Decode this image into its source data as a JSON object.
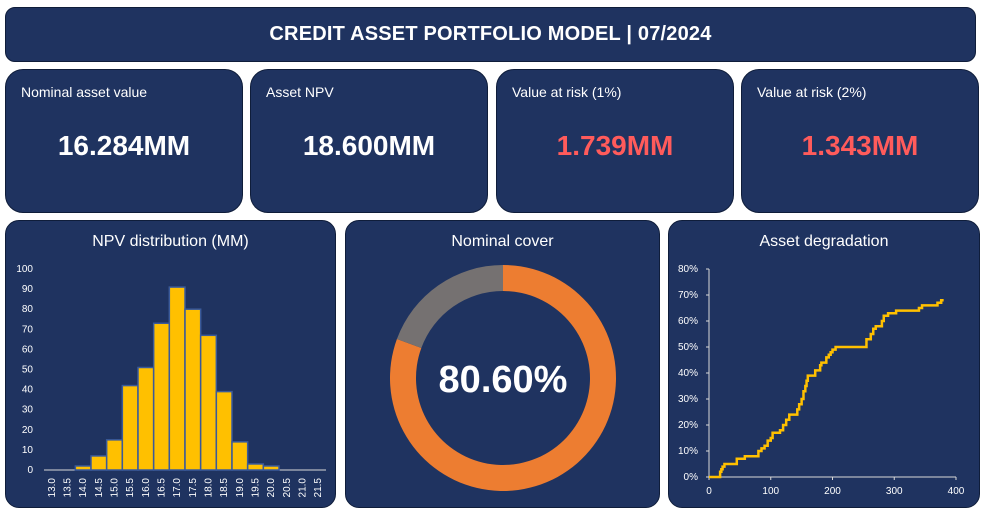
{
  "header": {
    "title": "CREDIT ASSET PORTFOLIO MODEL | 07/2024"
  },
  "kpis": [
    {
      "label": "Nominal asset value",
      "value": "16.284MM",
      "color": "#ffffff"
    },
    {
      "label": "Asset NPV",
      "value": "18.600MM",
      "color": "#ffffff"
    },
    {
      "label": "Value at risk (1%)",
      "value": "1.739MM",
      "color": "#ff5b5b"
    },
    {
      "label": "Value at risk (2%)",
      "value": "1.343MM",
      "color": "#ff5b5b"
    }
  ],
  "colors": {
    "panel": "#1f3360",
    "bar": "#ffc000",
    "donut_main": "#ed7d31",
    "donut_rest": "#757171",
    "line": "#ffc000"
  },
  "chart_data": [
    {
      "type": "bar",
      "title": "NPV distribution (MM)",
      "categories": [
        "13.0",
        "13.5",
        "14.0",
        "14.5",
        "15.0",
        "15.5",
        "16.0",
        "16.5",
        "17.0",
        "17.5",
        "18.0",
        "18.5",
        "19.0",
        "19.5",
        "20.0",
        "20.5",
        "21.0",
        "21.5"
      ],
      "values": [
        0,
        0,
        2,
        7,
        15,
        42,
        51,
        73,
        91,
        80,
        67,
        39,
        14,
        3,
        2,
        0,
        0,
        0
      ],
      "ylim": [
        0,
        100
      ],
      "yticks": [
        0,
        10,
        20,
        30,
        40,
        50,
        60,
        70,
        80,
        90,
        100
      ],
      "grid": false
    },
    {
      "type": "pie",
      "title": "Nominal cover",
      "center_label": "80.60%",
      "slices": [
        {
          "value": 80.6,
          "color": "#ed7d31"
        },
        {
          "value": 19.4,
          "color": "#757171"
        }
      ]
    },
    {
      "type": "line",
      "title": "Asset degradation",
      "xlim": [
        0,
        400
      ],
      "ylim": [
        0,
        80
      ],
      "xticks": [
        0,
        100,
        200,
        300,
        400
      ],
      "yticks": [
        "0%",
        "10%",
        "20%",
        "30%",
        "40%",
        "50%",
        "60%",
        "70%",
        "80%"
      ],
      "step": true,
      "points": [
        [
          0,
          0
        ],
        [
          15,
          0
        ],
        [
          18,
          2
        ],
        [
          20,
          3
        ],
        [
          22,
          4
        ],
        [
          25,
          5
        ],
        [
          40,
          5
        ],
        [
          45,
          7
        ],
        [
          55,
          7
        ],
        [
          58,
          8
        ],
        [
          75,
          8
        ],
        [
          80,
          10
        ],
        [
          85,
          11
        ],
        [
          90,
          12
        ],
        [
          95,
          14
        ],
        [
          100,
          15
        ],
        [
          103,
          17
        ],
        [
          112,
          17
        ],
        [
          115,
          18
        ],
        [
          120,
          20
        ],
        [
          125,
          22
        ],
        [
          130,
          24
        ],
        [
          140,
          24
        ],
        [
          143,
          26
        ],
        [
          146,
          28
        ],
        [
          150,
          30
        ],
        [
          153,
          33
        ],
        [
          156,
          35
        ],
        [
          158,
          37
        ],
        [
          160,
          39
        ],
        [
          170,
          39
        ],
        [
          172,
          41
        ],
        [
          178,
          41
        ],
        [
          180,
          43
        ],
        [
          182,
          44
        ],
        [
          188,
          44
        ],
        [
          190,
          46
        ],
        [
          194,
          47
        ],
        [
          197,
          48
        ],
        [
          200,
          49
        ],
        [
          205,
          50
        ],
        [
          250,
          50
        ],
        [
          255,
          53
        ],
        [
          262,
          55
        ],
        [
          266,
          57
        ],
        [
          270,
          58
        ],
        [
          276,
          58
        ],
        [
          280,
          60
        ],
        [
          283,
          62
        ],
        [
          290,
          63
        ],
        [
          300,
          63
        ],
        [
          303,
          64
        ],
        [
          340,
          65
        ],
        [
          345,
          66
        ],
        [
          370,
          67
        ],
        [
          376,
          68
        ],
        [
          380,
          68
        ]
      ]
    }
  ]
}
